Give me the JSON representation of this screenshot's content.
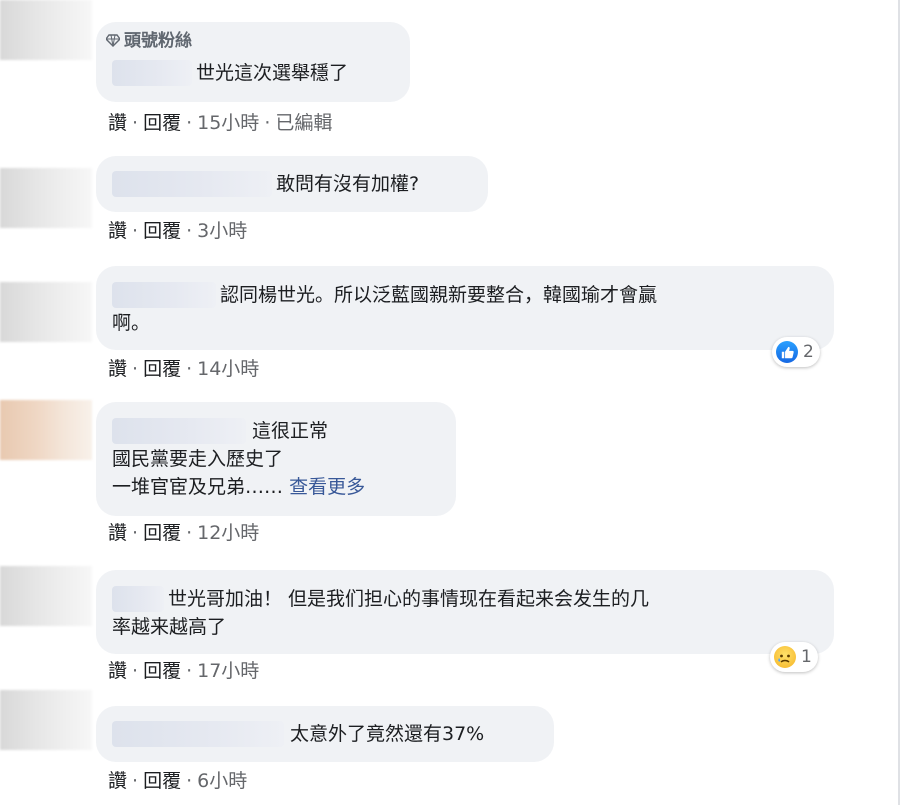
{
  "actions": {
    "like": "讚",
    "reply": "回覆",
    "sep": "·"
  },
  "comments": [
    {
      "badge": "頭號粉絲",
      "lines": [
        "世光這次選舉穩了"
      ],
      "time": "15小時",
      "edited": "已編輯"
    },
    {
      "lines": [
        "敢問有沒有加權?"
      ],
      "time": "3小時"
    },
    {
      "lines": [
        "認同楊世光。所以泛藍國親新要整合，韓國瑜才會贏",
        "啊。"
      ],
      "time": "14小時",
      "reaction": {
        "icon": "like-icon",
        "count": "2"
      }
    },
    {
      "lines": [
        "這很正常",
        "國民黨要走入歷史了",
        "一堆官宦及兄弟……"
      ],
      "see_more": "查看更多",
      "time": "12小時"
    },
    {
      "lines": [
        "世光哥加油！ 但是我们担心的事情现在看起来会发生的几",
        "率越来越高了"
      ],
      "time": "17小時",
      "reaction": {
        "icon": "sad-icon",
        "count": "1"
      }
    },
    {
      "lines": [
        "太意外了竟然還有37%"
      ],
      "time": "6小時"
    }
  ],
  "colors": {
    "bubble": "#f0f2f5",
    "link": "#385898",
    "meta": "#65676b",
    "like_blue": "#1877f2"
  }
}
